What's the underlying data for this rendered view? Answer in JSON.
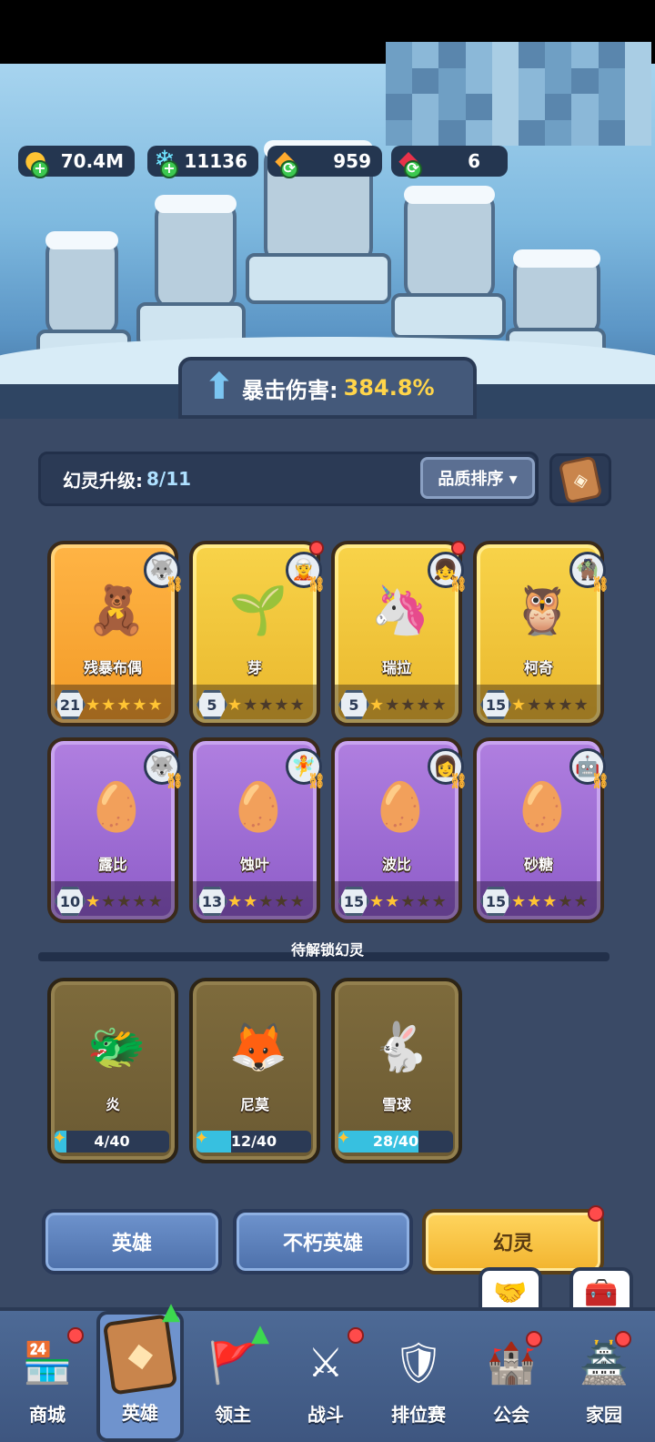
{
  "resources": [
    {
      "icon": "gold-coin-icon",
      "value": "70.4M"
    },
    {
      "icon": "blue-crystal-icon",
      "value": "11136"
    },
    {
      "icon": "orange-gem-icon",
      "value": "959"
    },
    {
      "icon": "red-gem-icon",
      "value": "6"
    }
  ],
  "crit": {
    "label": "暴击伤害:",
    "value": "384.8%"
  },
  "upgrade": {
    "label": "幻灵升级:",
    "count": "8/11",
    "sort_label": "品质排序 ▾"
  },
  "spirits": [
    {
      "name": "残暴布偶",
      "level": "21",
      "stars": 5,
      "rarity": "orange",
      "glyph": "🧸",
      "avatar": "🐺",
      "dot": false
    },
    {
      "name": "芽",
      "level": "5",
      "stars": 1,
      "rarity": "gold",
      "glyph": "🌱",
      "avatar": "🧝",
      "dot": true
    },
    {
      "name": "瑞拉",
      "level": "5",
      "stars": 1,
      "rarity": "gold",
      "glyph": "🦄",
      "avatar": "👧",
      "dot": true
    },
    {
      "name": "柯奇",
      "level": "15",
      "stars": 1,
      "rarity": "gold",
      "glyph": "🦉",
      "avatar": "🧌",
      "dot": false
    },
    {
      "name": "露比",
      "level": "10",
      "stars": 1,
      "rarity": "purple",
      "glyph": "🥚",
      "avatar": "🐺",
      "dot": false
    },
    {
      "name": "蚀叶",
      "level": "13",
      "stars": 2,
      "rarity": "purple",
      "glyph": "🥚",
      "avatar": "🧚",
      "dot": false
    },
    {
      "name": "波比",
      "level": "15",
      "stars": 2,
      "rarity": "purple",
      "glyph": "🥚",
      "avatar": "👩",
      "dot": false
    },
    {
      "name": "砂糖",
      "level": "15",
      "stars": 3,
      "rarity": "purple",
      "glyph": "🥚",
      "avatar": "🤖",
      "dot": false
    }
  ],
  "locked_section_label": "待解锁幻灵",
  "locked_spirits": [
    {
      "name": "炎",
      "progress": "4/40",
      "fraction": 0.1,
      "glyph": "🐲"
    },
    {
      "name": "尼莫",
      "progress": "12/40",
      "fraction": 0.3,
      "glyph": "🦊"
    },
    {
      "name": "雪球",
      "progress": "28/40",
      "fraction": 0.7,
      "glyph": "🐇"
    }
  ],
  "tabs": {
    "heroes": "英雄",
    "immortal_heroes": "不朽英雄",
    "spirits": "幻灵"
  },
  "nav": [
    {
      "label": "商城",
      "icon": "shop-icon",
      "glyph": "🏪"
    },
    {
      "label": "英雄",
      "icon": "hero-card-icon",
      "glyph": "◆"
    },
    {
      "label": "领主",
      "icon": "lord-banner-icon",
      "glyph": "🚩"
    },
    {
      "label": "战斗",
      "icon": "sword-icon",
      "glyph": "⚔"
    },
    {
      "label": "排位赛",
      "icon": "ranked-shield-icon",
      "glyph": "🛡"
    },
    {
      "label": "公会",
      "icon": "guild-castle-icon",
      "glyph": "🏰"
    },
    {
      "label": "家园",
      "icon": "home-castle-icon",
      "glyph": "🏯"
    }
  ]
}
